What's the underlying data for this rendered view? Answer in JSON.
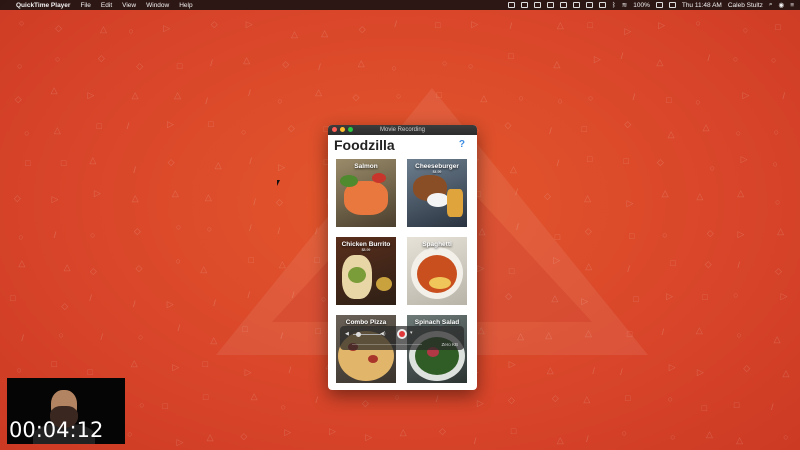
{
  "menubar": {
    "app_name": "QuickTime Player",
    "menus": [
      "File",
      "Edit",
      "View",
      "Window",
      "Help"
    ],
    "battery": "100%",
    "clock": "Thu 11:48 AM",
    "user": "Caleb Stultz"
  },
  "window": {
    "title": "Movie Recording",
    "app_title": "Foodzilla",
    "help_label": "?",
    "tiles": [
      {
        "name": "Salmon",
        "sub": ""
      },
      {
        "name": "Cheeseburger",
        "sub": "$4.99"
      },
      {
        "name": "Chicken Burrito",
        "sub": "$8.99"
      },
      {
        "name": "Spaghetti",
        "sub": ""
      },
      {
        "name": "Combo Pizza",
        "sub": ""
      },
      {
        "name": "Spinach Salad",
        "sub": ""
      }
    ]
  },
  "hud": {
    "file_size": "Zero KB",
    "volume_low_icon": "speaker-low-icon",
    "volume_high_icon": "speaker-high-icon"
  },
  "webcam": {
    "timer": "00:04:12"
  }
}
